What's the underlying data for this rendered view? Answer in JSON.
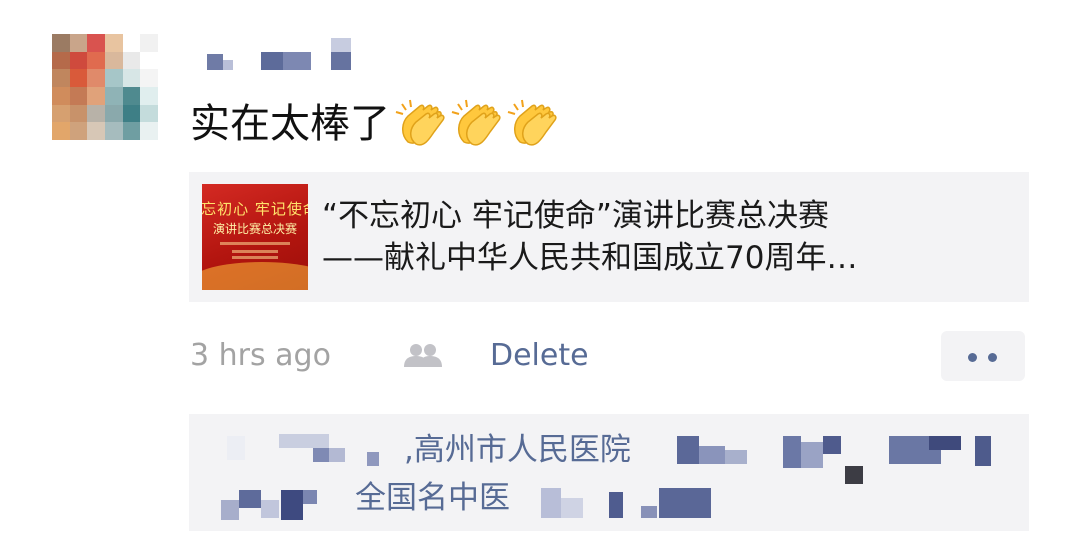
{
  "post": {
    "text": "实在太棒了",
    "reactions": [
      "clapping-hands",
      "clapping-hands",
      "clapping-hands"
    ]
  },
  "link_card": {
    "thumbnail_line1": "忘初心 牢记使命",
    "thumbnail_line2": "演讲比赛总决赛",
    "title_line1": "“不忘初心 牢记使命”演讲比赛总决赛",
    "title_line2": "——献礼中华人民共和国成立70周年…"
  },
  "footer": {
    "timestamp": "3 hrs ago",
    "visibility_icon": "group-icon",
    "delete_label": "Delete",
    "more_icon": "more-dots-icon"
  },
  "comments": {
    "line1_text": ",高州市人民医院",
    "line2_text": "全国名中医"
  },
  "colors": {
    "link_blue": "#576b95",
    "timestamp_gray": "#a3a3a3",
    "card_bg": "#f3f3f5",
    "thumb_red": "#d42a23"
  }
}
